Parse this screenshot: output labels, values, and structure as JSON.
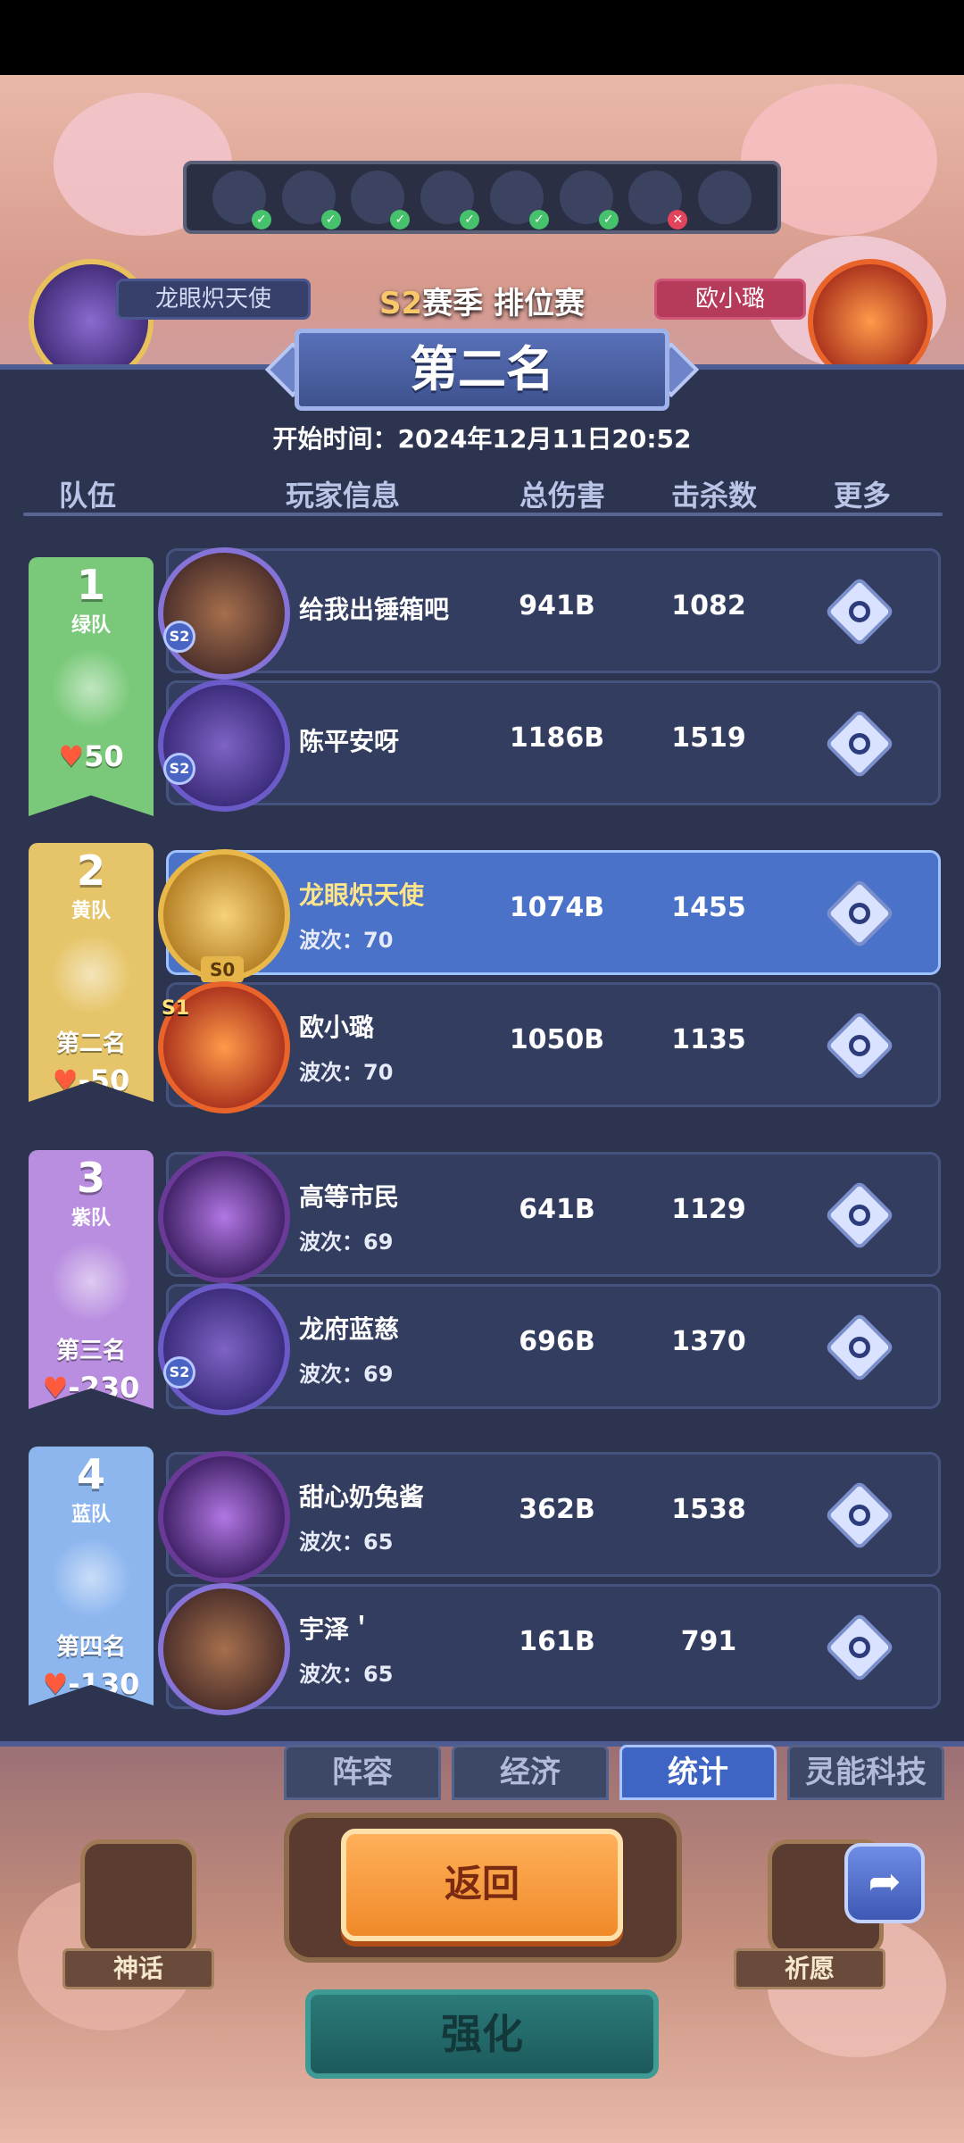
{
  "top_bar": {
    "slots": [
      {
        "icon": "leaf-skill-icon",
        "status": "ok"
      },
      {
        "icon": "dark-hero-icon",
        "status": "ok"
      },
      {
        "icon": "sword-icon",
        "status": "ok"
      },
      {
        "icon": "shadow-hero-icon",
        "status": "ok"
      },
      {
        "icon": "wings-icon",
        "status": "ok"
      },
      {
        "icon": "ice-hero-icon",
        "status": "ok"
      },
      {
        "icon": "flame-icon",
        "status": "blocked"
      },
      {
        "icon": "mech-hero-icon",
        "status": "none"
      }
    ]
  },
  "background": {
    "left_player": "龙眼炽天使",
    "right_player": "欧小璐",
    "season_prefix": "S2",
    "season_title": "赛季 排位赛"
  },
  "panel": {
    "title": "第二名",
    "start_time": "开始时间：2024年12月11日20:52",
    "headers": {
      "team": "队伍",
      "player": "玩家信息",
      "damage": "总伤害",
      "kills": "击杀数",
      "more": "更多"
    }
  },
  "teams": [
    {
      "rank": "1",
      "name": "绿队",
      "place": "",
      "score": "50",
      "color": "#7ac97a",
      "players": [
        {
          "name": "给我出锤箱吧",
          "wave": "",
          "damage": "941B",
          "kills": "1082",
          "avatar": "brown",
          "badge": "S2"
        },
        {
          "name": "陈平安呀",
          "wave": "",
          "damage": "1186B",
          "kills": "1519",
          "avatar": "purple",
          "badge": "S2"
        }
      ]
    },
    {
      "rank": "2",
      "name": "黄队",
      "place": "第二名",
      "score": "-50",
      "color": "#e6c56a",
      "players": [
        {
          "name": "龙眼炽天使",
          "wave": "波次：70",
          "damage": "1074B",
          "kills": "1455",
          "avatar": "gold",
          "badge": "S0",
          "highlight": true
        },
        {
          "name": "欧小璐",
          "wave": "波次：70",
          "damage": "1050B",
          "kills": "1135",
          "avatar": "fire",
          "badge": "S1"
        }
      ]
    },
    {
      "rank": "3",
      "name": "紫队",
      "place": "第三名",
      "score": "-230",
      "color": "#b98ee0",
      "players": [
        {
          "name": "高等市民",
          "wave": "波次：69",
          "damage": "641B",
          "kills": "1129",
          "avatar": "dark",
          "badge": ""
        },
        {
          "name": "龙府蓝慈",
          "wave": "波次：69",
          "damage": "696B",
          "kills": "1370",
          "avatar": "purple",
          "badge": "S2"
        }
      ]
    },
    {
      "rank": "4",
      "name": "蓝队",
      "place": "第四名",
      "score": "-130",
      "color": "#8db6ef",
      "players": [
        {
          "name": "甜心奶兔酱",
          "wave": "波次：65",
          "damage": "362B",
          "kills": "1538",
          "avatar": "dark",
          "badge": ""
        },
        {
          "name": "宇泽＇",
          "wave": "波次：65",
          "damage": "161B",
          "kills": "791",
          "avatar": "brown",
          "badge": ""
        }
      ]
    }
  ],
  "tabs": [
    {
      "label": "阵容",
      "active": false
    },
    {
      "label": "经济",
      "active": false
    },
    {
      "label": "统计",
      "active": true
    },
    {
      "label": "灵能科技",
      "active": false
    }
  ],
  "bottom": {
    "return_label": "返回",
    "strengthen_label": "强化",
    "myth_label": "神话",
    "wish_label": "祈愿",
    "share_icon": "share-icon"
  }
}
